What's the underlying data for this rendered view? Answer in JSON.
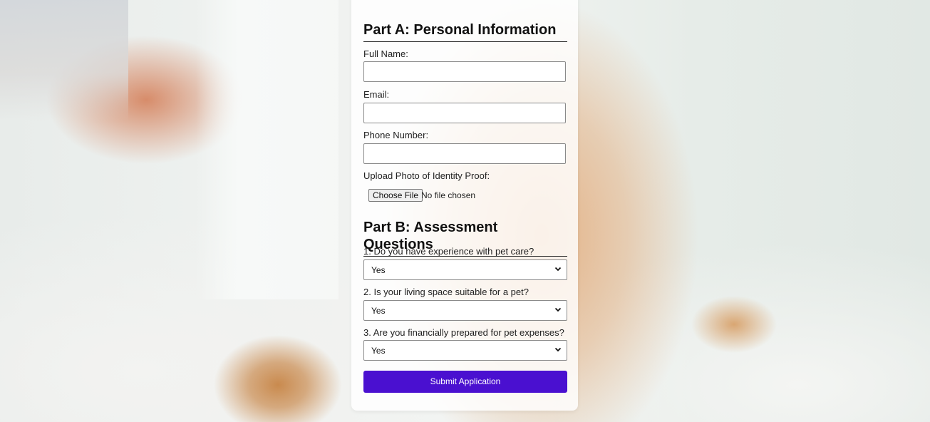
{
  "partA": {
    "title": "Part A: Personal Information",
    "full_name_label": "Full Name:",
    "full_name_value": "",
    "email_label": "Email:",
    "email_value": "",
    "phone_label": "Phone Number:",
    "phone_value": "",
    "upload_label": "Upload Photo of Identity Proof:",
    "choose_file_label": "Choose File",
    "file_status": "No file chosen"
  },
  "partB": {
    "title": "Part B: Assessment Questions",
    "questions": [
      {
        "label": "1. Do you have experience with pet care?",
        "selected": "Yes"
      },
      {
        "label": "2. Is your living space suitable for a pet?",
        "selected": "Yes"
      },
      {
        "label": "3. Are you financially prepared for pet expenses?",
        "selected": "Yes"
      }
    ]
  },
  "submit_label": "Submit Application",
  "colors": {
    "submit_button": "#4a10d0",
    "card_background": "rgba(255,255,255,0.82)"
  },
  "icons": {
    "select_arrow": "chevron-down-icon"
  }
}
